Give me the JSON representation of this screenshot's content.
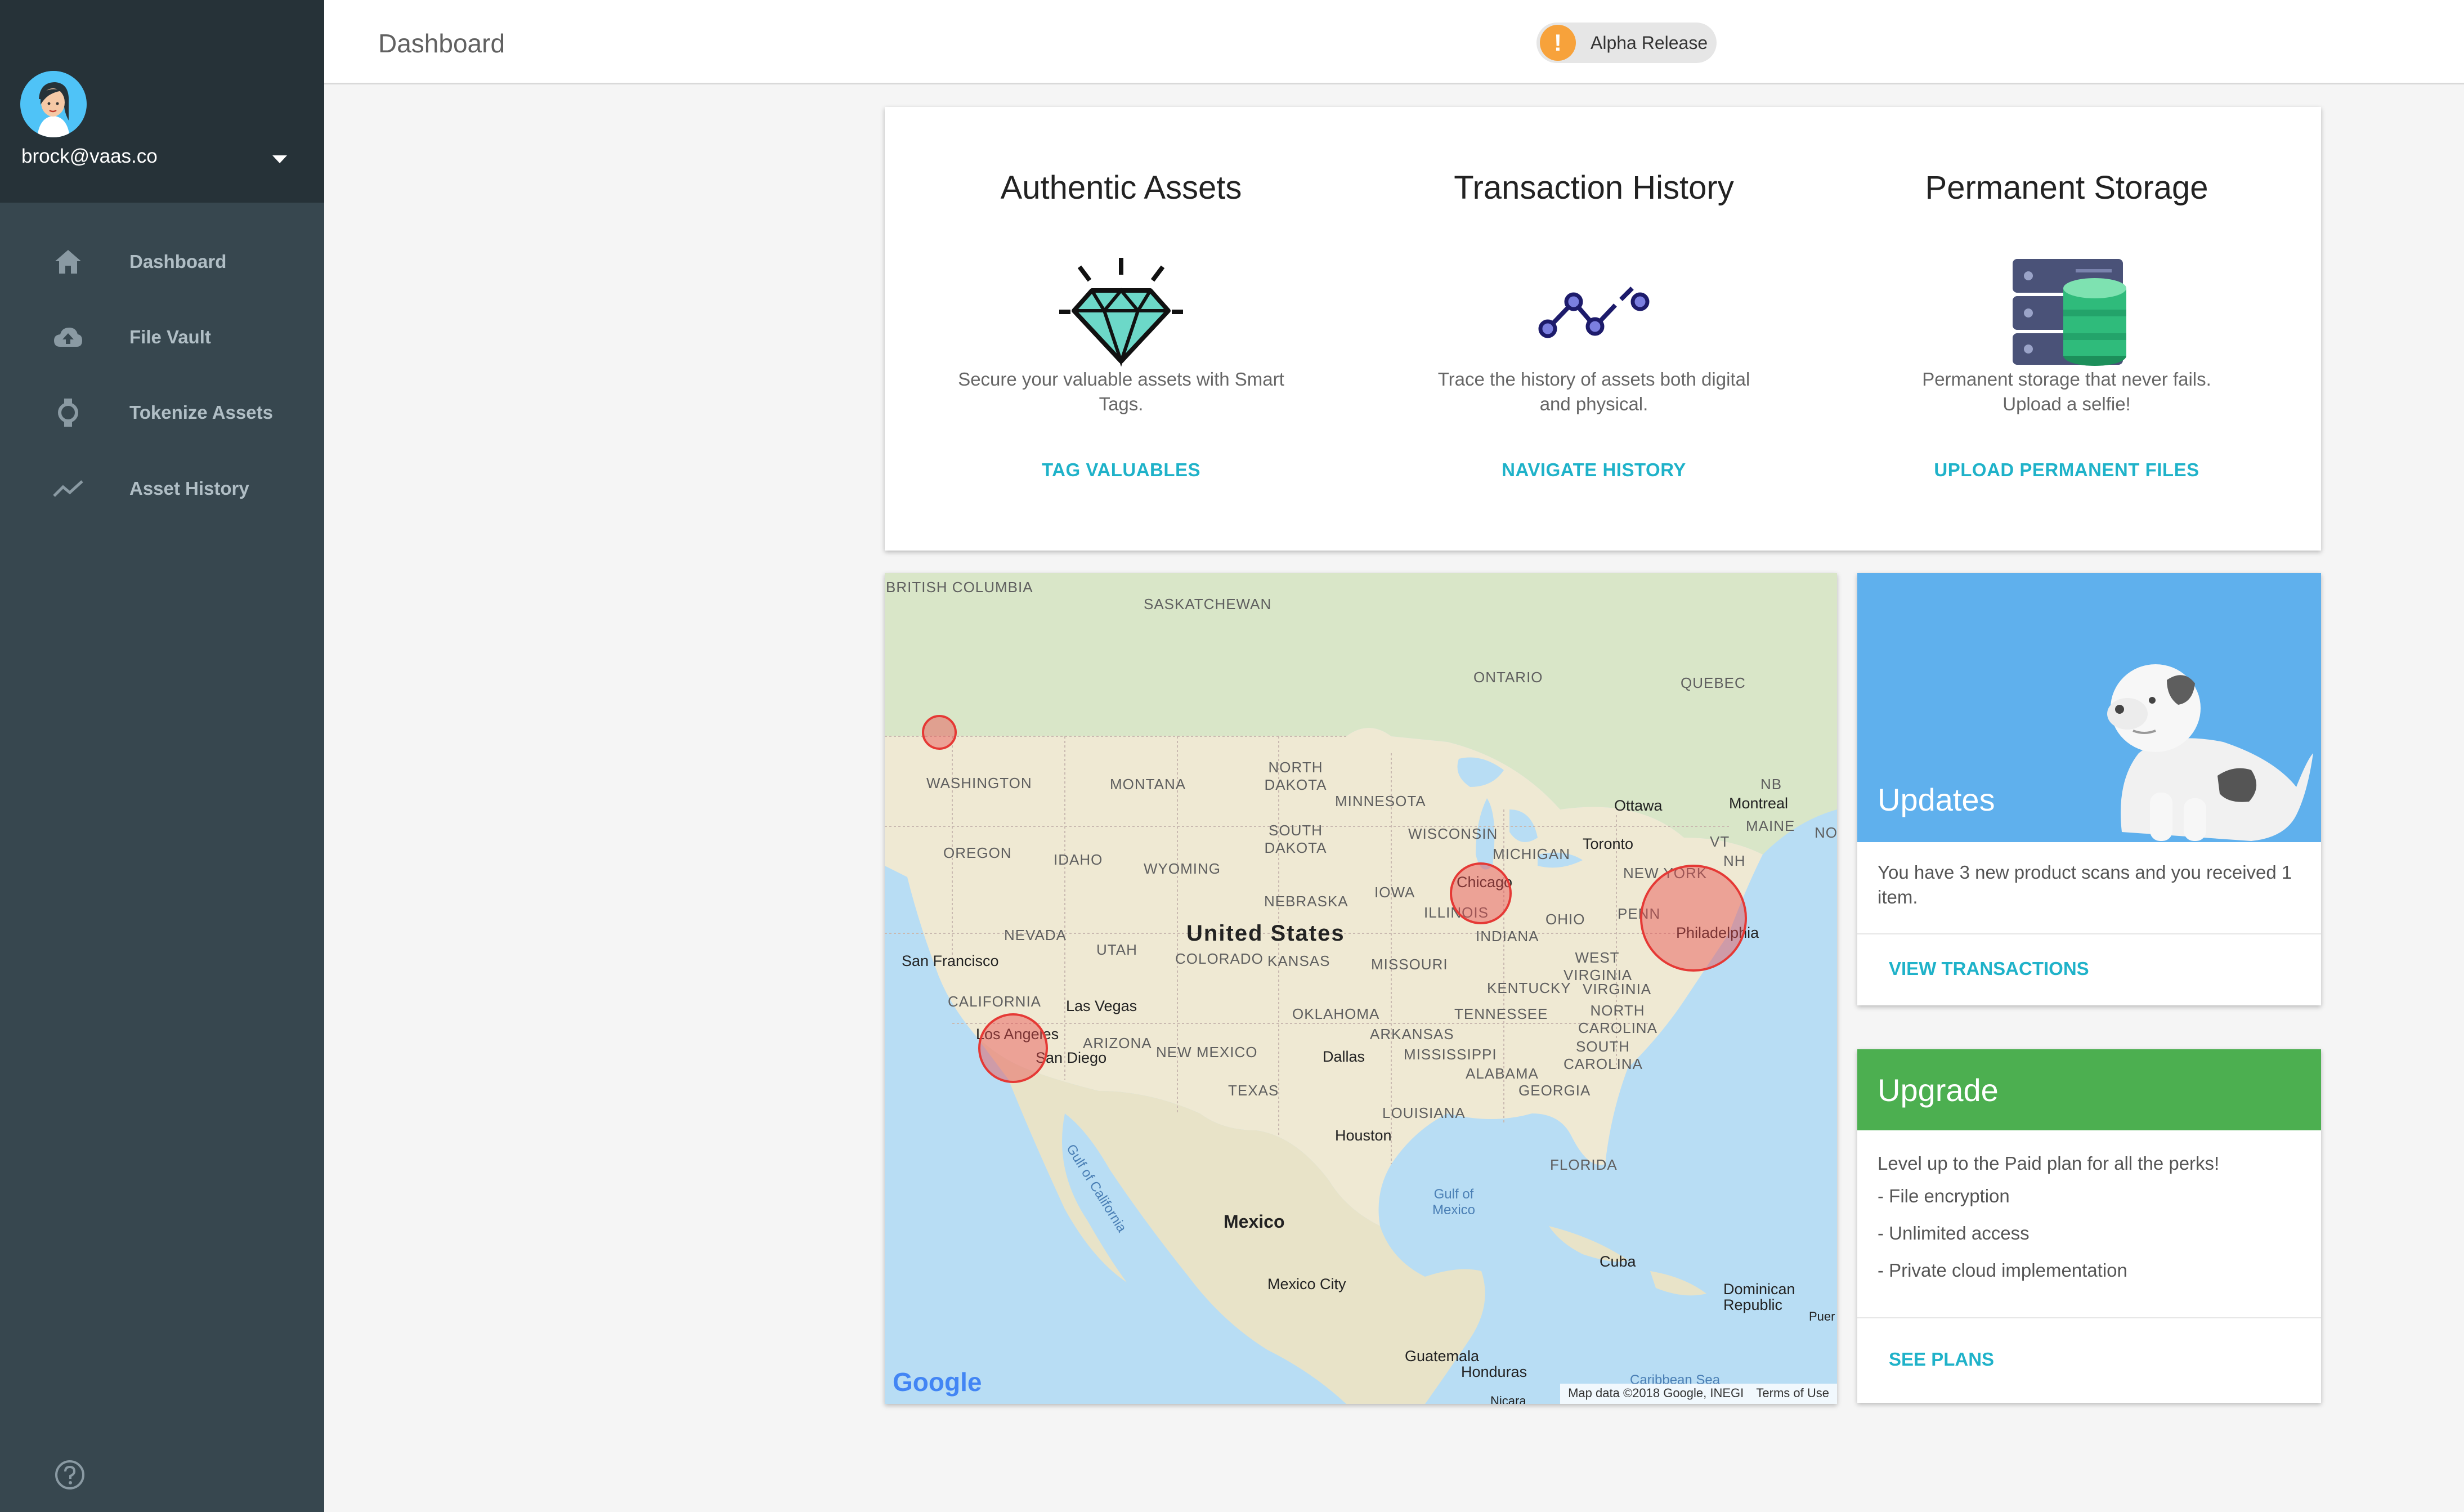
{
  "user": {
    "email": "brock@vaas.co"
  },
  "sidebar": {
    "items": [
      {
        "label": "Dashboard",
        "icon": "home-icon"
      },
      {
        "label": "File Vault",
        "icon": "cloud-upload-icon"
      },
      {
        "label": "Tokenize Assets",
        "icon": "watch-icon"
      },
      {
        "label": "Asset History",
        "icon": "trending-icon"
      }
    ],
    "help_icon": "help-icon"
  },
  "header": {
    "title": "Dashboard",
    "badge_label": "Alpha Release",
    "badge_icon": "!"
  },
  "features": [
    {
      "title": "Authentic Assets",
      "icon": "diamond-icon",
      "description": "Secure your valuable assets with Smart Tags.",
      "action": "TAG VALUABLES"
    },
    {
      "title": "Transaction History",
      "icon": "graph-icon",
      "description": "Trace the history of assets both digital and physical.",
      "action": "NAVIGATE HISTORY"
    },
    {
      "title": "Permanent Storage",
      "icon": "database-icon",
      "description": "Permanent storage that never fails. Upload a selfie!",
      "action": "UPLOAD PERMANENT FILES"
    }
  ],
  "map": {
    "country_label": "United States",
    "mexico_label": "Mexico",
    "regions": [
      "BRITISH COLUMBIA",
      "SASKATCHEWAN",
      "ONTARIO",
      "QUEBEC",
      "WASHINGTON",
      "MONTANA",
      "NORTH DAKOTA",
      "MINNESOTA",
      "NB",
      "MAINE",
      "OREGON",
      "IDAHO",
      "WYOMING",
      "SOUTH DAKOTA",
      "WISCONSIN",
      "MICHIGAN",
      "VT",
      "NH",
      "NEBRASKA",
      "IOWA",
      "ILLINOIS",
      "NEW YORK",
      "NEVADA",
      "UTAH",
      "COLORADO",
      "KANSAS",
      "MISSOURI",
      "INDIANA",
      "OHIO",
      "PENN",
      "CALIFORNIA",
      "ARIZONA",
      "NEW MEXICO",
      "OKLAHOMA",
      "ARKANSAS",
      "TENNESSEE",
      "KENTUCKY",
      "WEST VIRGINIA",
      "VIRGINIA",
      "NORTH CAROLINA",
      "SOUTH CAROLINA",
      "TEXAS",
      "MISSISSIPPI",
      "ALABAMA",
      "GEORGIA",
      "LOUISIANA",
      "FLORIDA"
    ],
    "cities": [
      "Ottawa",
      "Montreal",
      "Toronto",
      "Chicago",
      "Philadelphia",
      "San Francisco",
      "Las Vegas",
      "Los Angeles",
      "San Diego",
      "Dallas",
      "Houston",
      "Mexico City",
      "Cuba",
      "Guatemala",
      "Honduras"
    ],
    "water": [
      "Gulf of California",
      "Gulf of Mexico",
      "Caribbean Sea"
    ],
    "other_labels": [
      "Dominican Republic",
      "Puer",
      "Nicara",
      "NOV"
    ],
    "attribution": "Map data ©2018 Google, INEGI",
    "terms": "Terms of Use",
    "logo": "Google",
    "clusters": [
      {
        "name": "Seattle",
        "size": "small"
      },
      {
        "name": "Chicago",
        "size": "medium"
      },
      {
        "name": "Philadelphia",
        "size": "large"
      },
      {
        "name": "Los Angeles",
        "size": "medium"
      }
    ]
  },
  "updates": {
    "title": "Updates",
    "message": "You have 3 new product scans and you received 1 item.",
    "action": "VIEW TRANSACTIONS"
  },
  "upgrade": {
    "title": "Upgrade",
    "intro": "Level up to the Paid plan for all the perks!",
    "perks": [
      "- File encryption",
      "- Unlimited access",
      "- Private cloud implementation"
    ],
    "action": "SEE PLANS"
  },
  "colors": {
    "sidebar": "#37474f",
    "sidebar_head": "#263238",
    "accent": "#1fb2c9",
    "updates_header": "#5fb0ed",
    "upgrade_header": "#4caf50",
    "badge": "#f7a23b",
    "cluster": "#e53935"
  }
}
